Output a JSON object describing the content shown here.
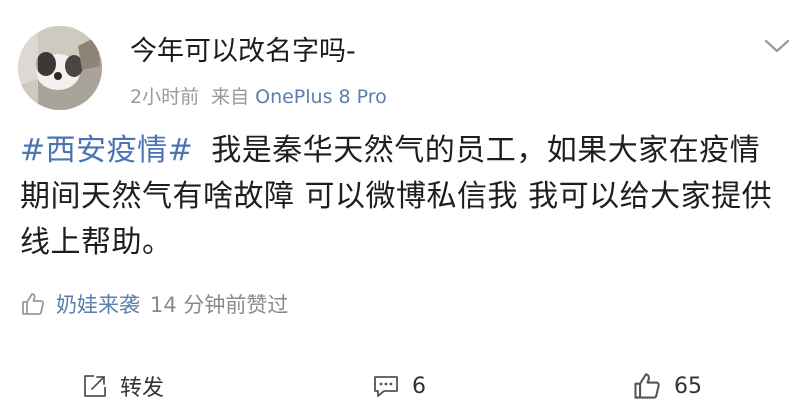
{
  "post": {
    "username": "今年可以改名字吗-",
    "time": "2小时前",
    "source_prefix": "来自",
    "device": "OnePlus 8 Pro",
    "hashtag": "#西安疫情#",
    "body_text": "我是秦华天然气的员工，如果大家在疫情期间天然气有啥故障 可以微博私信我 我可以给大家提供线上帮助。"
  },
  "liked_by": {
    "user": "奶娃来袭",
    "text": "14 分钟前赞过"
  },
  "actions": {
    "repost_label": "转发",
    "comment_count": "6",
    "like_count": "65"
  },
  "icons": {
    "avatar": "avatar-image",
    "more": "chevron-down-icon",
    "liked": "thumbs-up-icon",
    "repost": "repost-icon",
    "comment": "comment-icon",
    "like": "thumbs-up-icon"
  },
  "colors": {
    "link": "#4a74b4",
    "meta": "#9a9a9a",
    "text": "#1e1e1e"
  }
}
